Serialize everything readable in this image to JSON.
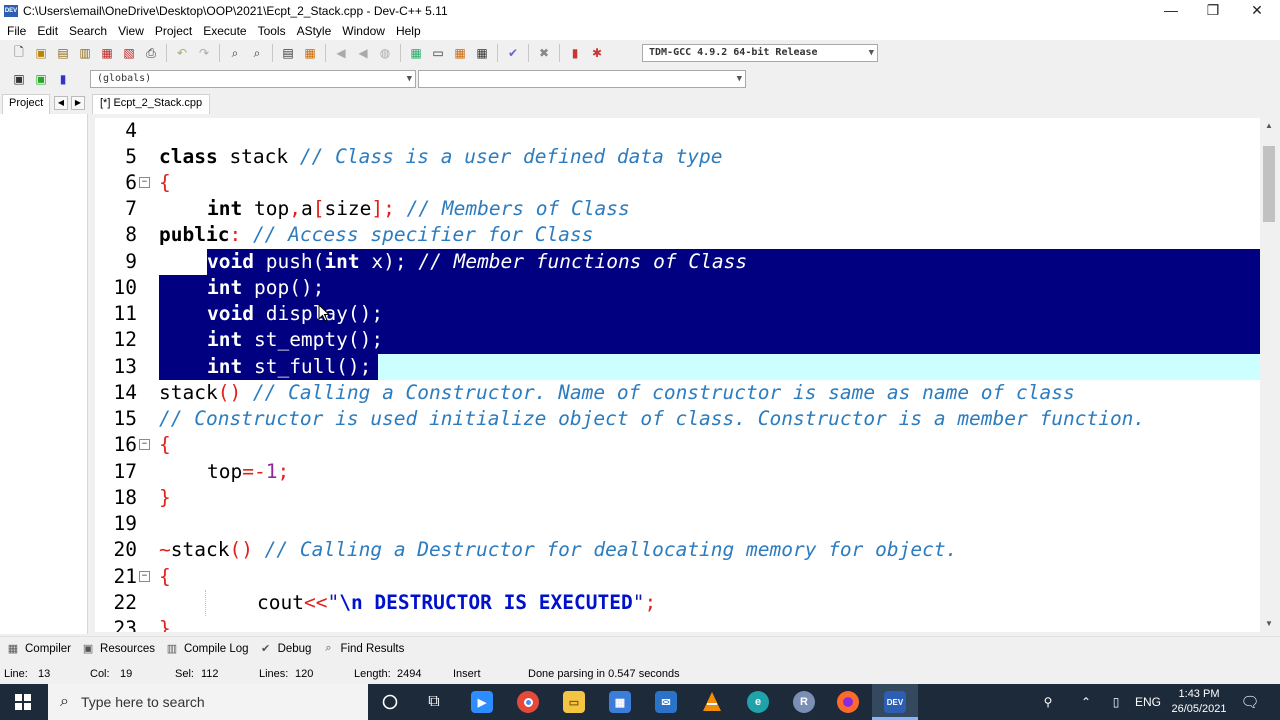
{
  "window": {
    "title": "C:\\Users\\email\\OneDrive\\Desktop\\OOP\\2021\\Ecpt_2_Stack.cpp - Dev-C++ 5.11",
    "icon_text": "DEV"
  },
  "menu": [
    "File",
    "Edit",
    "Search",
    "View",
    "Project",
    "Execute",
    "Tools",
    "AStyle",
    "Window",
    "Help"
  ],
  "toolbar": {
    "compiler_select": "TDM-GCC 4.9.2 64-bit Release",
    "globals_select": "(globals)",
    "member_select": ""
  },
  "tabs": {
    "project": "Project",
    "file": "[*] Ecpt_2_Stack.cpp"
  },
  "editor": {
    "lines": [
      {
        "num": "4"
      },
      {
        "num": "5"
      },
      {
        "num": "6"
      },
      {
        "num": "7"
      },
      {
        "num": "8"
      },
      {
        "num": "9"
      },
      {
        "num": "10"
      },
      {
        "num": "11"
      },
      {
        "num": "12"
      },
      {
        "num": "13"
      },
      {
        "num": "14"
      },
      {
        "num": "15"
      },
      {
        "num": "16"
      },
      {
        "num": "17"
      },
      {
        "num": "18"
      },
      {
        "num": "19"
      },
      {
        "num": "20"
      },
      {
        "num": "21"
      },
      {
        "num": "22"
      },
      {
        "num": "23"
      }
    ],
    "code": {
      "l5_kw": "class",
      "l5_name": " stack ",
      "l5_cm": "// Class is a user defined data type",
      "l6_brace": "{",
      "l7_kw": "int",
      "l7_a": " top",
      "l7_comma": ",",
      "l7_b": "a",
      "l7_lb": "[",
      "l7_c": "size",
      "l7_rb": "];",
      "l7_cm": " // Members of Class",
      "l8_kw": "public",
      "l8_colon": ":",
      "l8_cm": " // Access specifier for Class",
      "l9_kw": "void",
      "l9_a": " push(",
      "l9_kw2": "int",
      "l9_b": " x);",
      "l9_cm": " // Member functions of Class",
      "l10_kw": "int",
      "l10_a": " pop();",
      "l11_kw": "void",
      "l11_a": " display();",
      "l12_kw": "int",
      "l12_a": " st_empty();",
      "l13_kw": "int",
      "l13_a": " st_full();",
      "l14_a": "stack",
      "l14_p": "()",
      "l14_cm": " // Calling a Constructor. Name of constructor is same as name of class",
      "l15_cm": "// Constructor is used initialize object of class. Constructor is a member function.",
      "l16_brace": "{",
      "l17_a": "top",
      "l17_op": "=-",
      "l17_num": "1",
      "l17_semi": ";",
      "l18_brace": "}",
      "l20_tilde": "~",
      "l20_a": "stack",
      "l20_p": "()",
      "l20_cm": " // Calling a Destructor for deallocating memory for object.",
      "l21_brace": "{",
      "l22_a": "cout",
      "l22_op": "<<",
      "l22_q1": "\"",
      "l22_esc": "\\n DESTRUCTOR IS EXECUTED",
      "l22_q2": "\"",
      "l22_semi": ";",
      "l23_brace": "}"
    }
  },
  "bottom_tabs": [
    "Compiler",
    "Resources",
    "Compile Log",
    "Debug",
    "Find Results"
  ],
  "status": {
    "line_label": "Line:",
    "line_val": "13",
    "col_label": "Col:",
    "col_val": "19",
    "sel_label": "Sel:",
    "sel_val": "112",
    "lines_label": "Lines:",
    "lines_val": "120",
    "length_label": "Length:",
    "length_val": "2494",
    "mode": "Insert",
    "message": "Done parsing in 0.547 seconds"
  },
  "taskbar": {
    "search_placeholder": "Type here to search",
    "lang": "ENG",
    "time": "1:43 PM",
    "date": "26/05/2021"
  },
  "colors": {
    "selection": "#000080",
    "current_line": "#ccffff",
    "comment": "#2c7cbf",
    "operator": "#e0201a",
    "taskbar": "#1c2a3a"
  }
}
